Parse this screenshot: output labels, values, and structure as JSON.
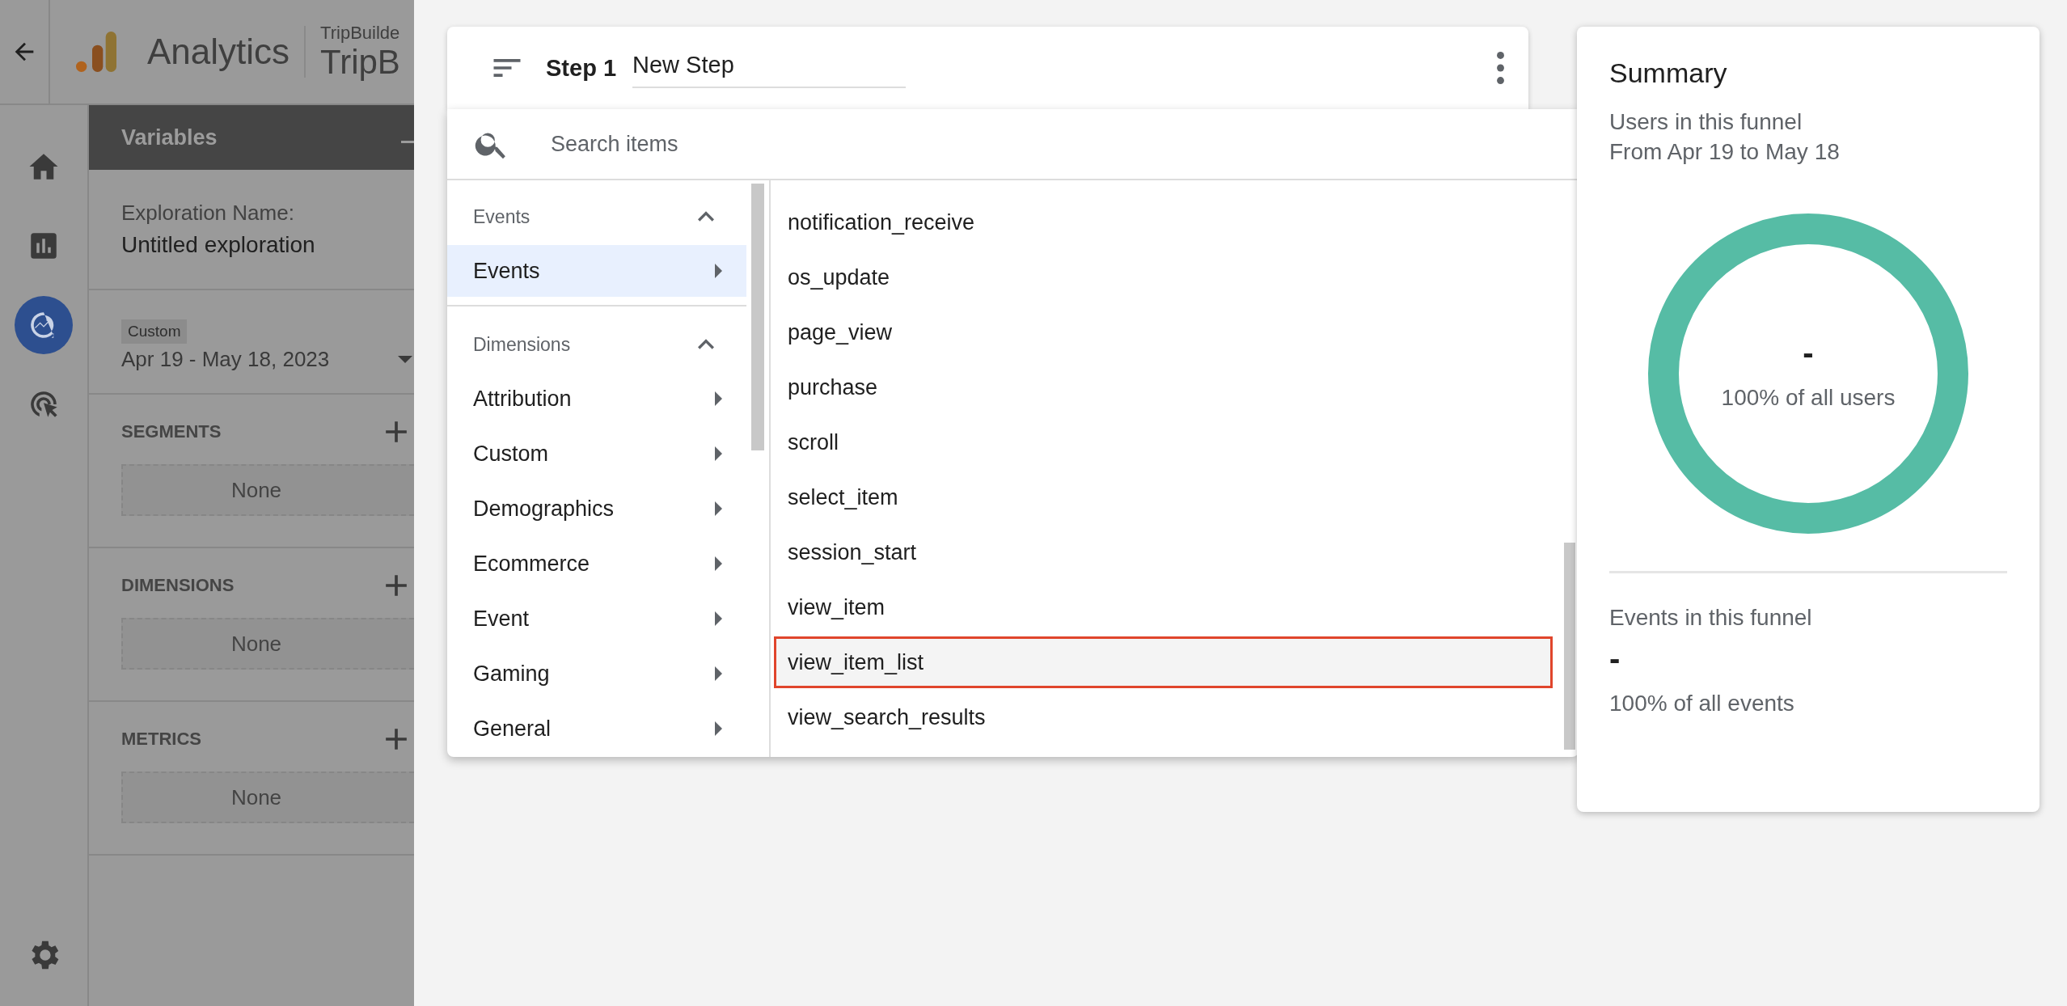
{
  "app_bar": {
    "title": "Analytics",
    "account": "TripBuilde",
    "property": "TripB"
  },
  "nav_rail": [
    {
      "selected": false
    },
    {
      "selected": false
    },
    {
      "selected": true
    },
    {
      "selected": false
    }
  ],
  "variables": {
    "title": "Variables",
    "name_label": "Exploration Name:",
    "name": "Untitled exploration",
    "date_badge": "Custom",
    "date_range": "Apr 19 - May 18, 2023",
    "sections": [
      {
        "title": "SEGMENTS",
        "empty": "None"
      },
      {
        "title": "DIMENSIONS",
        "empty": "None"
      },
      {
        "title": "METRICS",
        "empty": "None"
      }
    ]
  },
  "step": {
    "label": "Step 1",
    "name": "New Step"
  },
  "picker": {
    "search": {
      "placeholder": "Search items"
    },
    "groups": [
      {
        "title": "Events",
        "expanded": true,
        "items": [
          {
            "label": "Events",
            "selected": true
          }
        ]
      },
      {
        "title": "Dimensions",
        "expanded": true,
        "items": [
          {
            "label": "Attribution",
            "selected": false
          },
          {
            "label": "Custom",
            "selected": false
          },
          {
            "label": "Demographics",
            "selected": false
          },
          {
            "label": "Ecommerce",
            "selected": false
          },
          {
            "label": "Event",
            "selected": false
          },
          {
            "label": "Gaming",
            "selected": false
          },
          {
            "label": "General",
            "selected": false
          }
        ]
      }
    ],
    "items": [
      {
        "label": "notification_receive",
        "selected": false
      },
      {
        "label": "os_update",
        "selected": false
      },
      {
        "label": "page_view",
        "selected": false
      },
      {
        "label": "purchase",
        "selected": false
      },
      {
        "label": "scroll",
        "selected": false
      },
      {
        "label": "select_item",
        "selected": false
      },
      {
        "label": "session_start",
        "selected": false
      },
      {
        "label": "view_item",
        "selected": false
      },
      {
        "label": "view_item_list",
        "selected": true
      },
      {
        "label": "view_search_results",
        "selected": false
      }
    ]
  },
  "summary": {
    "title": "Summary",
    "users_label": "Users in this funnel",
    "date_range": "From Apr 19 to May 18",
    "users_value": "-",
    "users_caption": "100% of all users",
    "events_label": "Events in this funnel",
    "events_value": "-",
    "events_caption": "100% of all events"
  }
}
